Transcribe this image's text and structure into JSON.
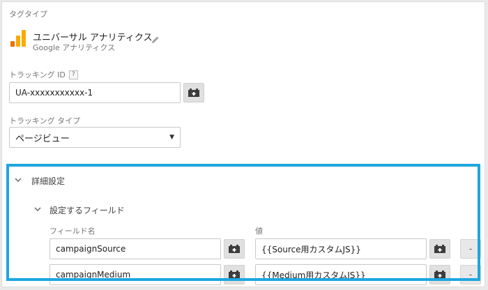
{
  "tag_type": {
    "section_label": "タグタイプ",
    "name": "ユニバーサル アナリティクス",
    "vendor": "Google アナリティクス"
  },
  "tracking_id": {
    "label": "トラッキング ID",
    "help": "?",
    "value": "UA-xxxxxxxxxxx-1"
  },
  "tracking_type": {
    "label": "トラッキング タイプ",
    "selected": "ページビュー"
  },
  "advanced": {
    "label": "詳細設定",
    "fields_label": "設定するフィールド",
    "col_field_name": "フィールド名",
    "col_value": "値",
    "rows": [
      {
        "field": "campaignSource",
        "value": "{{Source用カスタムJS}}",
        "remove": "-"
      },
      {
        "field": "campaignMedium",
        "value": "{{Medium用カスタムJS}}",
        "remove": "-"
      }
    ]
  },
  "colors": {
    "highlight": "#1ea6e0",
    "ga_orange": "#f9ab00",
    "ga_dark_orange": "#e37400"
  }
}
